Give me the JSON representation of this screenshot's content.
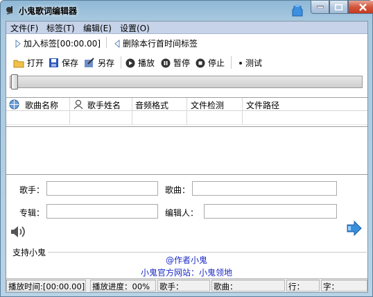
{
  "window": {
    "title": "小鬼歌词编辑器"
  },
  "menu": [
    "文件(F)",
    "标签(T)",
    "编辑(E)",
    "设置(O)"
  ],
  "toolbar1": {
    "add_tag": "加入标签[00:00.00]",
    "delete_tag": "删除本行首时间标签"
  },
  "toolbar2": {
    "open": "打开",
    "save": "保存",
    "save_as": "另存",
    "play": "播放",
    "pause": "暂停",
    "stop": "停止",
    "test": "测试"
  },
  "progress": {
    "position": 0
  },
  "song_list": {
    "columns": [
      "歌曲名称",
      "歌手姓名",
      "音频格式",
      "文件检测",
      "文件路径"
    ],
    "rows": []
  },
  "form": {
    "artist_label": "歌手：",
    "song_label": "歌曲：",
    "album_label": "专辑：",
    "editor_label": "编辑人：",
    "artist_value": "",
    "song_value": "",
    "album_value": "",
    "editor_value": ""
  },
  "support": {
    "group_title": "支持小鬼",
    "author": "@作者小鬼",
    "website": "小鬼官方网站：小鬼领地"
  },
  "status": {
    "play_time": "播放时间:[00:00.00]",
    "play_progress": "播放进度：00%",
    "artist": "歌手：",
    "song": "歌曲：",
    "line": "行：",
    "char": "字："
  },
  "colors": {
    "menubar": "#c7d3e9",
    "link_blue": "#1a2ac8"
  }
}
